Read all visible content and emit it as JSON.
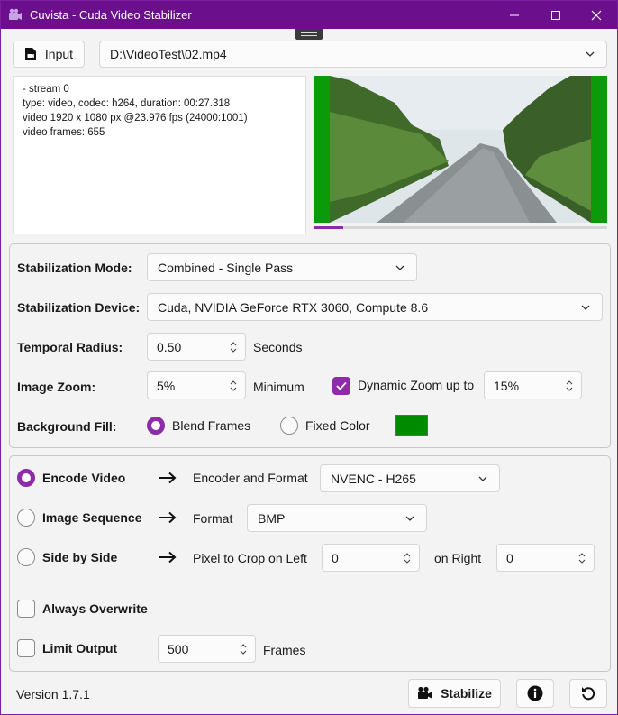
{
  "window": {
    "title": "Cuvista - Cuda Video Stabilizer"
  },
  "input": {
    "button_label": "Input",
    "file_path": "D:\\VideoTest\\02.mp4",
    "info_lines": [
      "- stream 0",
      "type: video, codec: h264, duration: 00:27.318",
      "video 1920 x 1080 px @23.976 fps (24000:1001)",
      "video frames: 655"
    ],
    "preview_progress": 0.1
  },
  "settings": {
    "stabilization_mode_label": "Stabilization Mode:",
    "stabilization_mode_value": "Combined - Single Pass",
    "stabilization_device_label": "Stabilization Device:",
    "stabilization_device_value": "Cuda, NVIDIA GeForce RTX 3060, Compute 8.6",
    "temporal_radius_label": "Temporal Radius:",
    "temporal_radius_value": "0.50",
    "temporal_radius_unit": "Seconds",
    "image_zoom_label": "Image Zoom:",
    "image_zoom_value": "5%",
    "image_zoom_suffix": "Minimum",
    "dynamic_zoom_label": "Dynamic Zoom up to",
    "dynamic_zoom_checked": true,
    "dynamic_zoom_value": "15%",
    "background_fill_label": "Background Fill:",
    "blend_frames_label": "Blend Frames",
    "fixed_color_label": "Fixed Color",
    "fill_mode_selected": "Blend Frames",
    "fixed_color_swatch": "#008a00"
  },
  "output": {
    "encode_video_label": "Encode Video",
    "encoder_format_label": "Encoder and Format",
    "encoder_value": "NVENC - H265",
    "image_sequence_label": "Image Sequence",
    "format_label": "Format",
    "format_value": "BMP",
    "side_by_side_label": "Side by Side",
    "crop_left_label": "Pixel to Crop on Left",
    "crop_left_value": "0",
    "on_right_label": "on Right",
    "crop_right_value": "0",
    "selected_mode": "Encode Video",
    "always_overwrite_label": "Always Overwrite",
    "always_overwrite_checked": false,
    "limit_output_label": "Limit Output",
    "limit_output_checked": false,
    "limit_frames_value": "500",
    "frames_label": "Frames"
  },
  "footer": {
    "version": "Version 1.7.1",
    "stabilize_label": "Stabilize",
    "info_icon": "info-icon",
    "reset_icon": "reset-icon"
  },
  "colors": {
    "accent": "#8e2ba8",
    "titlebar": "#6b0f8c"
  }
}
